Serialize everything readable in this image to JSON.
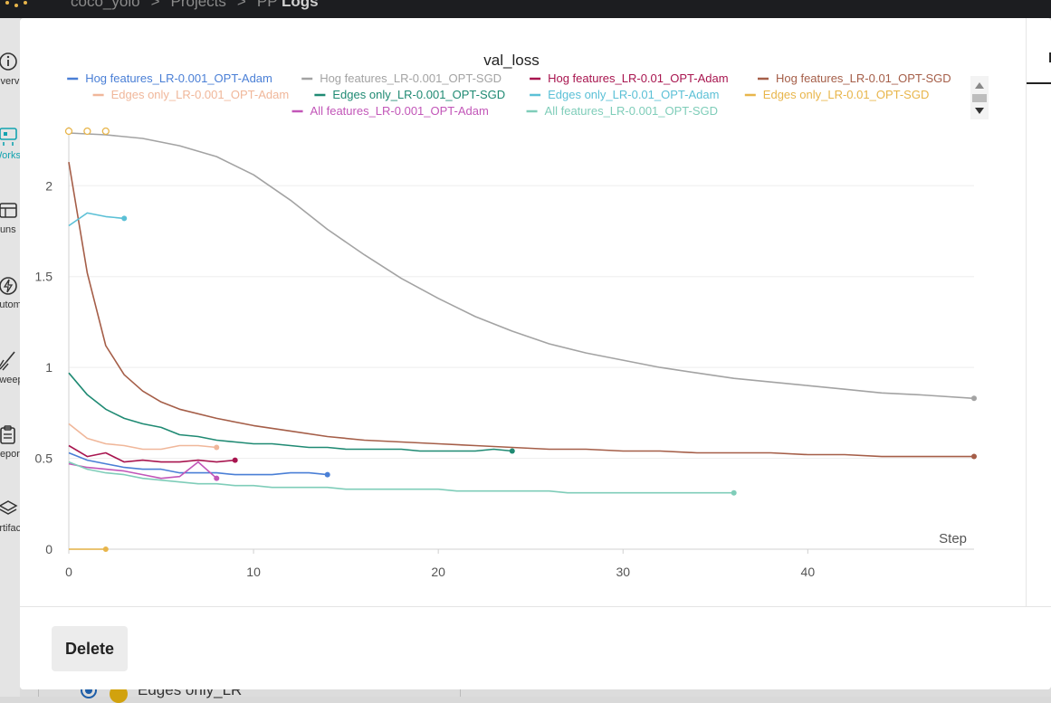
{
  "breadcrumb": {
    "project": "coco_yolo",
    "section": "Projects",
    "current_prefix": "PP",
    "current": "Logs",
    "separator": ">"
  },
  "nav": [
    {
      "id": "overview",
      "label": "Overview"
    },
    {
      "id": "workspace",
      "label": "Workspace",
      "active": true
    },
    {
      "id": "runs",
      "label": "Runs"
    },
    {
      "id": "automations",
      "label": "Automations"
    },
    {
      "id": "sweeps",
      "label": "Sweeps"
    },
    {
      "id": "reports",
      "label": "Reports"
    },
    {
      "id": "artifacts",
      "label": "Artifacts"
    }
  ],
  "footer": {
    "delete_label": "Delete"
  },
  "background_run": {
    "label": "Edges only_LR"
  },
  "side_panel": {
    "tab_initial": "I"
  },
  "chart_data": {
    "type": "line",
    "title": "val_loss",
    "xlabel": "Step",
    "ylabel": "",
    "xlim": [
      0,
      49
    ],
    "ylim": [
      0,
      2.3
    ],
    "xticks": [
      0,
      10,
      20,
      30,
      40
    ],
    "yticks": [
      0,
      0.5,
      1,
      1.5,
      2
    ],
    "ytick_labels": [
      "0",
      "0.5",
      "1",
      "1.5",
      "2"
    ],
    "grid": true,
    "legend_position": "top",
    "series": [
      {
        "name": "Hog features_LR-0.001_OPT-Adam",
        "color": "#4a7fd6",
        "x": [
          0,
          1,
          2,
          3,
          4,
          5,
          6,
          7,
          8,
          9,
          10,
          11,
          12,
          13,
          14
        ],
        "y": [
          0.53,
          0.49,
          0.47,
          0.45,
          0.44,
          0.44,
          0.42,
          0.42,
          0.42,
          0.41,
          0.41,
          0.41,
          0.42,
          0.42,
          0.41
        ]
      },
      {
        "name": "Hog features_LR-0.001_OPT-SGD",
        "color": "#a3a3a3",
        "x": [
          0,
          2,
          4,
          6,
          8,
          10,
          12,
          14,
          16,
          18,
          20,
          22,
          24,
          26,
          28,
          30,
          32,
          34,
          36,
          38,
          40,
          42,
          44,
          46,
          49
        ],
        "y": [
          2.29,
          2.28,
          2.26,
          2.22,
          2.16,
          2.06,
          1.92,
          1.76,
          1.62,
          1.49,
          1.38,
          1.28,
          1.2,
          1.13,
          1.08,
          1.04,
          1.0,
          0.97,
          0.94,
          0.92,
          0.9,
          0.88,
          0.86,
          0.85,
          0.83
        ]
      },
      {
        "name": "Hog features_LR-0.01_OPT-Adam",
        "color": "#a8154f",
        "x": [
          0,
          1,
          2,
          3,
          4,
          5,
          6,
          7,
          8,
          9
        ],
        "y": [
          0.57,
          0.51,
          0.53,
          0.48,
          0.49,
          0.48,
          0.48,
          0.49,
          0.48,
          0.49
        ]
      },
      {
        "name": "Hog features_LR-0.01_OPT-SGD",
        "color": "#a55e48",
        "x": [
          0,
          1,
          2,
          3,
          4,
          5,
          6,
          8,
          10,
          12,
          14,
          16,
          18,
          20,
          22,
          24,
          26,
          28,
          30,
          32,
          34,
          36,
          38,
          40,
          42,
          44,
          46,
          49
        ],
        "y": [
          2.13,
          1.52,
          1.12,
          0.96,
          0.87,
          0.81,
          0.77,
          0.72,
          0.68,
          0.65,
          0.62,
          0.6,
          0.59,
          0.58,
          0.57,
          0.56,
          0.55,
          0.55,
          0.54,
          0.54,
          0.53,
          0.53,
          0.53,
          0.52,
          0.52,
          0.51,
          0.51,
          0.51
        ]
      },
      {
        "name": "Edges only_LR-0.001_OPT-Adam",
        "color": "#f0b79a",
        "x": [
          0,
          1,
          2,
          3,
          4,
          5,
          6,
          7,
          8
        ],
        "y": [
          0.69,
          0.61,
          0.58,
          0.57,
          0.55,
          0.55,
          0.57,
          0.57,
          0.56
        ]
      },
      {
        "name": "Edges only_LR-0.001_OPT-SGD",
        "color": "#1f8a73",
        "x": [
          0,
          1,
          2,
          3,
          4,
          5,
          6,
          7,
          8,
          9,
          10,
          11,
          12,
          13,
          14,
          15,
          16,
          17,
          18,
          19,
          20,
          21,
          22,
          23,
          24
        ],
        "y": [
          0.97,
          0.85,
          0.77,
          0.72,
          0.69,
          0.67,
          0.63,
          0.62,
          0.6,
          0.59,
          0.58,
          0.58,
          0.57,
          0.56,
          0.56,
          0.55,
          0.55,
          0.55,
          0.55,
          0.54,
          0.54,
          0.54,
          0.54,
          0.55,
          0.54
        ]
      },
      {
        "name": "Edges only_LR-0.01_OPT-Adam",
        "color": "#5bc0d6",
        "x": [
          0,
          1,
          2,
          3
        ],
        "y": [
          1.78,
          1.85,
          1.83,
          1.82
        ]
      },
      {
        "name": "Edges only_LR-0.01_OPT-SGD",
        "color": "#e8b54a",
        "x": [
          0,
          1,
          2
        ],
        "y": [
          0,
          0,
          0
        ],
        "open_markers": {
          "x": [
            0,
            1,
            2
          ],
          "y": [
            2.3,
            2.3,
            2.3
          ]
        }
      },
      {
        "name": "All features_LR-0.001_OPT-Adam",
        "color": "#c256b8",
        "x": [
          0,
          1,
          2,
          3,
          4,
          5,
          6,
          7,
          8
        ],
        "y": [
          0.47,
          0.45,
          0.44,
          0.43,
          0.41,
          0.39,
          0.4,
          0.48,
          0.39
        ]
      },
      {
        "name": "All features_LR-0.001_OPT-SGD",
        "color": "#7fcdb9",
        "x": [
          0,
          1,
          2,
          3,
          4,
          5,
          6,
          7,
          8,
          9,
          10,
          11,
          12,
          13,
          14,
          15,
          16,
          17,
          18,
          19,
          20,
          21,
          22,
          23,
          24,
          25,
          26,
          27,
          28,
          29,
          30,
          31,
          32,
          33,
          34,
          35,
          36
        ],
        "y": [
          0.48,
          0.44,
          0.42,
          0.41,
          0.39,
          0.38,
          0.37,
          0.36,
          0.36,
          0.35,
          0.35,
          0.34,
          0.34,
          0.34,
          0.34,
          0.33,
          0.33,
          0.33,
          0.33,
          0.33,
          0.33,
          0.32,
          0.32,
          0.32,
          0.32,
          0.32,
          0.32,
          0.31,
          0.31,
          0.31,
          0.31,
          0.31,
          0.31,
          0.31,
          0.31,
          0.31,
          0.31
        ]
      }
    ]
  }
}
